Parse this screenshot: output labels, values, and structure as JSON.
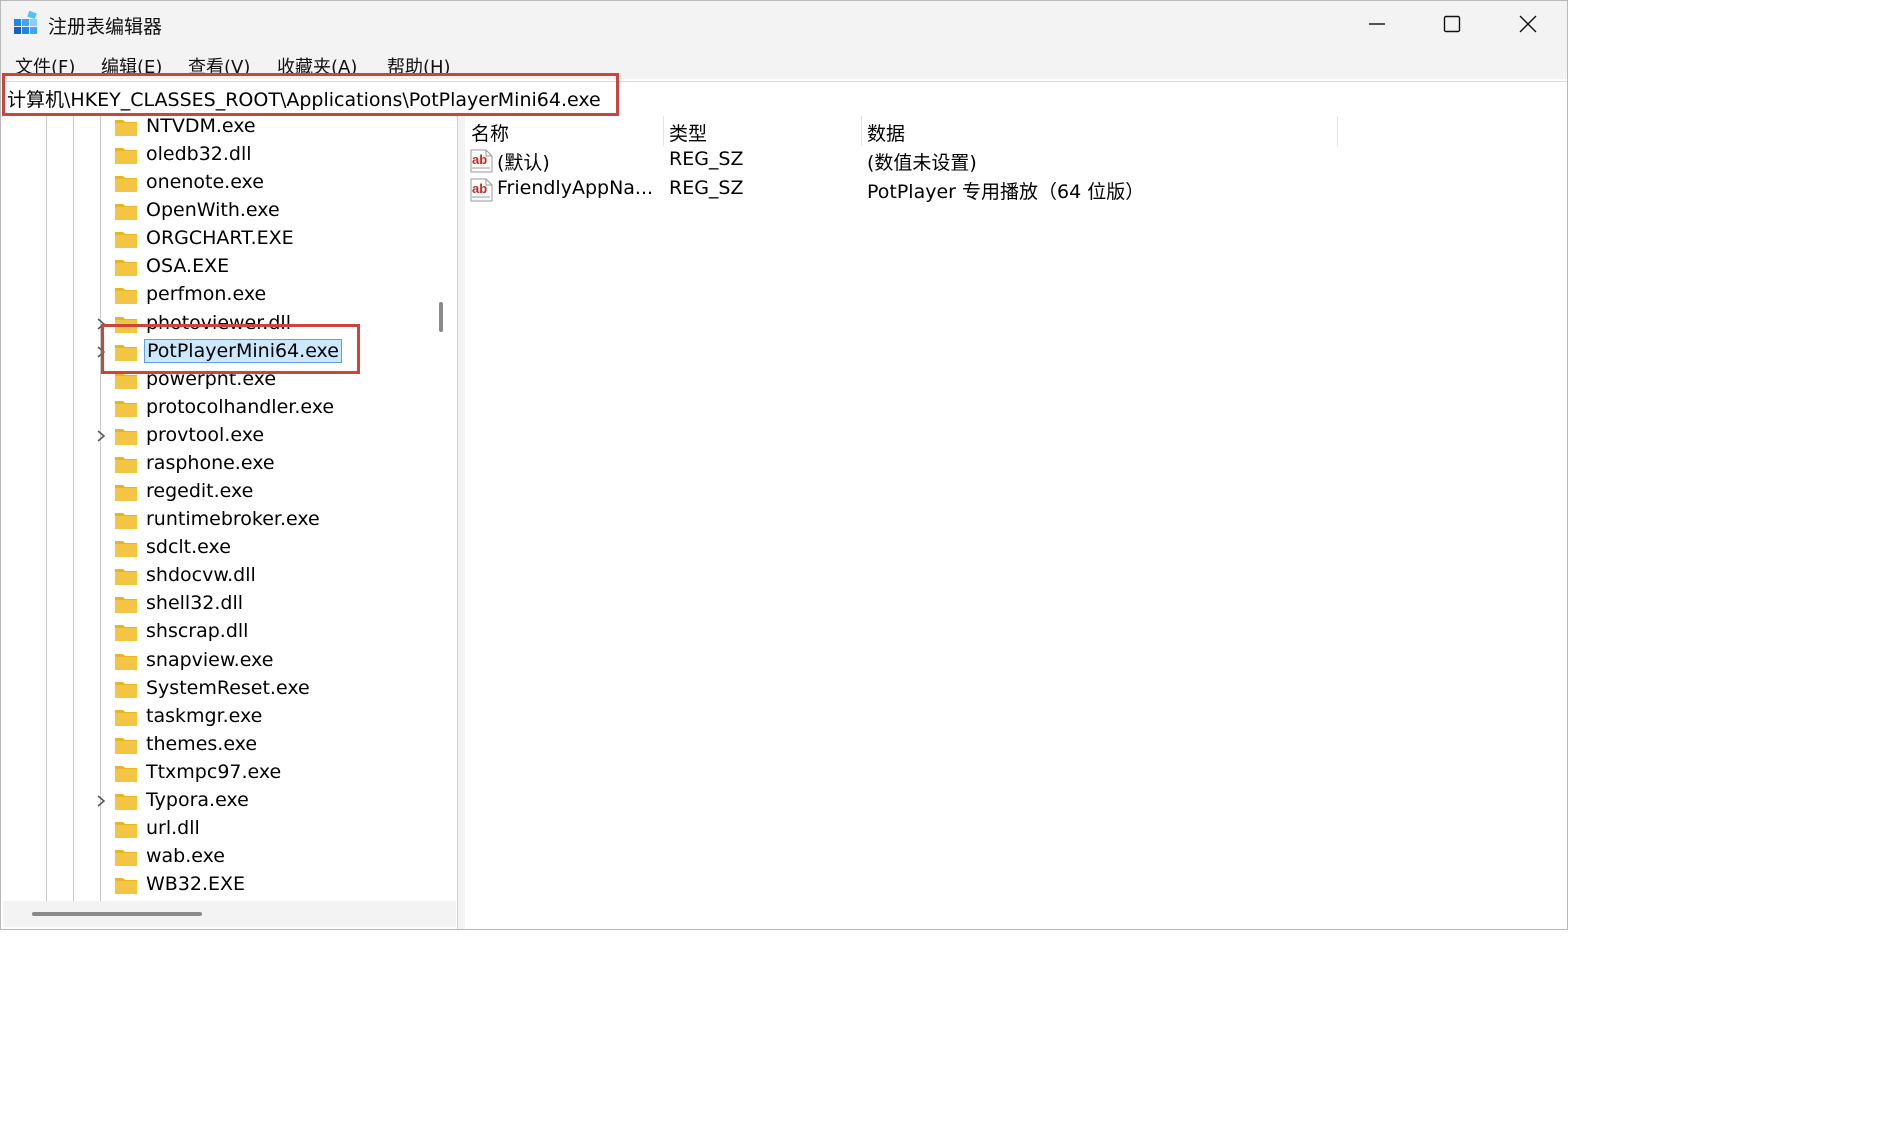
{
  "window": {
    "title": "注册表编辑器",
    "icon": "registry-editor-icon"
  },
  "menu": [
    "文件(F)",
    "编辑(E)",
    "查看(V)",
    "收藏夹(A)",
    "帮助(H)"
  ],
  "address": {
    "path": "计算机\\HKEY_CLASSES_ROOT\\Applications\\PotPlayerMini64.exe"
  },
  "tree": {
    "items": [
      {
        "label": "NTVDM.exe",
        "expandable": false,
        "selected": false
      },
      {
        "label": "oledb32.dll",
        "expandable": false,
        "selected": false
      },
      {
        "label": "onenote.exe",
        "expandable": false,
        "selected": false
      },
      {
        "label": "OpenWith.exe",
        "expandable": false,
        "selected": false
      },
      {
        "label": "ORGCHART.EXE",
        "expandable": false,
        "selected": false
      },
      {
        "label": "OSA.EXE",
        "expandable": false,
        "selected": false
      },
      {
        "label": "perfmon.exe",
        "expandable": false,
        "selected": false
      },
      {
        "label": "photoviewer.dll",
        "expandable": true,
        "selected": false
      },
      {
        "label": "PotPlayerMini64.exe",
        "expandable": true,
        "selected": true
      },
      {
        "label": "powerpnt.exe",
        "expandable": false,
        "selected": false
      },
      {
        "label": "protocolhandler.exe",
        "expandable": false,
        "selected": false
      },
      {
        "label": "provtool.exe",
        "expandable": true,
        "selected": false
      },
      {
        "label": "rasphone.exe",
        "expandable": false,
        "selected": false
      },
      {
        "label": "regedit.exe",
        "expandable": false,
        "selected": false
      },
      {
        "label": "runtimebroker.exe",
        "expandable": false,
        "selected": false
      },
      {
        "label": "sdclt.exe",
        "expandable": false,
        "selected": false
      },
      {
        "label": "shdocvw.dll",
        "expandable": false,
        "selected": false
      },
      {
        "label": "shell32.dll",
        "expandable": false,
        "selected": false
      },
      {
        "label": "shscrap.dll",
        "expandable": false,
        "selected": false
      },
      {
        "label": "snapview.exe",
        "expandable": false,
        "selected": false
      },
      {
        "label": "SystemReset.exe",
        "expandable": false,
        "selected": false
      },
      {
        "label": "taskmgr.exe",
        "expandable": false,
        "selected": false
      },
      {
        "label": "themes.exe",
        "expandable": false,
        "selected": false
      },
      {
        "label": "Ttxmpc97.exe",
        "expandable": false,
        "selected": false
      },
      {
        "label": "Typora.exe",
        "expandable": true,
        "selected": false
      },
      {
        "label": "url.dll",
        "expandable": false,
        "selected": false
      },
      {
        "label": "wab.exe",
        "expandable": false,
        "selected": false
      },
      {
        "label": "WB32.EXE",
        "expandable": false,
        "selected": false
      }
    ]
  },
  "list": {
    "columns": [
      "名称",
      "类型",
      "数据"
    ],
    "rows": [
      {
        "name": "(默认)",
        "type": "REG_SZ",
        "data": "(数值未设置)",
        "icon": "string-value-icon"
      },
      {
        "name": "FriendlyAppNa...",
        "type": "REG_SZ",
        "data": "PotPlayer 专用播放（64 位版）",
        "icon": "string-value-icon"
      }
    ]
  },
  "colors": {
    "highlight_box": "#c9463d",
    "selection_bg": "#cce8ff",
    "folder": "#f4c542"
  }
}
